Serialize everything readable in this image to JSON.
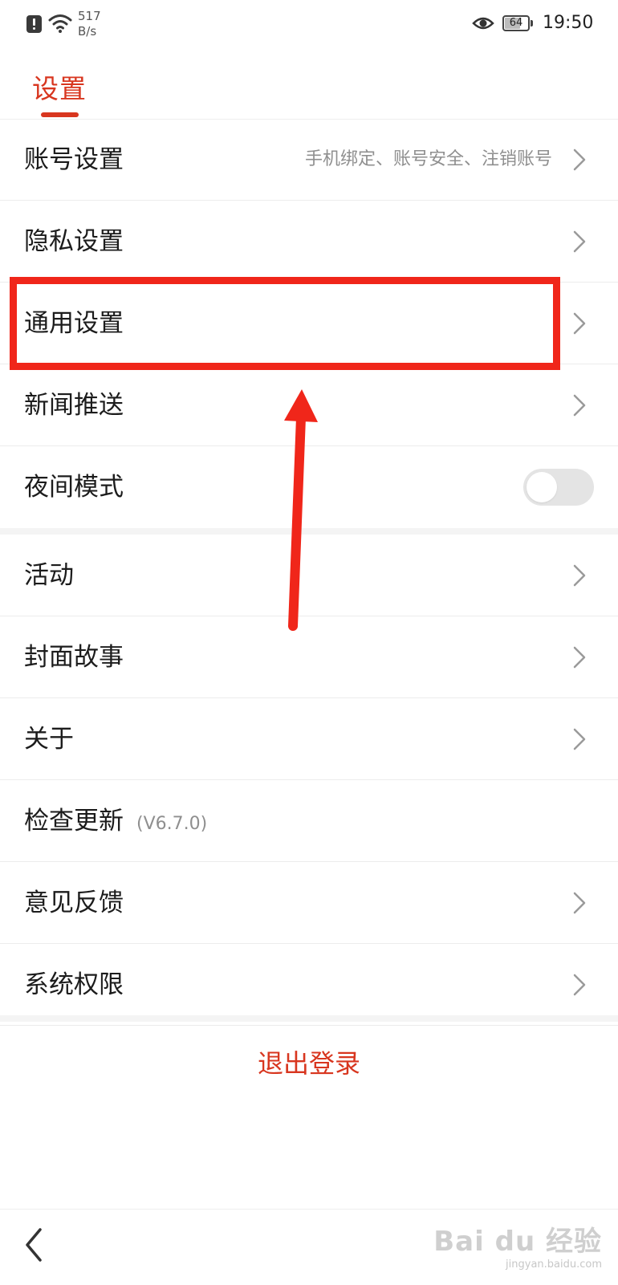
{
  "status_bar": {
    "speed_value": "517",
    "speed_unit": "B/s",
    "battery": "64",
    "time": "19:50"
  },
  "header": {
    "title": "设置"
  },
  "settings": [
    {
      "label": "账号设置",
      "hint": "手机绑定、账号安全、注销账号"
    },
    {
      "label": "隐私设置"
    },
    {
      "label": "通用设置"
    },
    {
      "label": "新闻推送"
    },
    {
      "label": "夜间模式",
      "toggle": "off"
    },
    {
      "label": "活动"
    },
    {
      "label": "封面故事"
    },
    {
      "label": "关于"
    },
    {
      "label": "检查更新",
      "version": "(V6.7.0)"
    },
    {
      "label": "意见反馈"
    },
    {
      "label": "系统权限"
    }
  ],
  "logout_label": "退出登录",
  "watermark": {
    "main": "Bai du 经验",
    "sub": "jingyan.baidu.com"
  },
  "colors": {
    "accent": "#d8361f",
    "annotation": "#f0261a"
  }
}
